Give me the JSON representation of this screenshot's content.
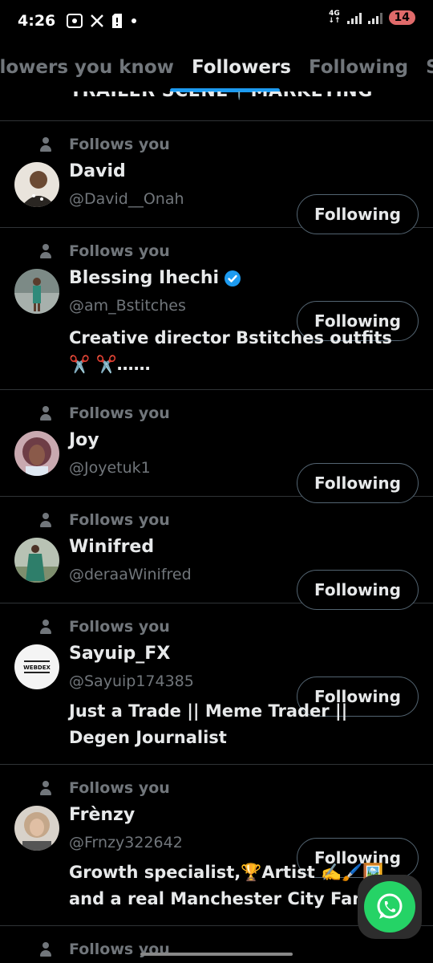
{
  "status": {
    "time": "4:26",
    "network": "4G",
    "battery": "14"
  },
  "tabs": [
    {
      "label": "Followers you know"
    },
    {
      "label": "Followers"
    },
    {
      "label": "Following"
    },
    {
      "label": "Subscriptions"
    }
  ],
  "partial_top_text": "TRAILER SCENE📍MARKETING",
  "follows_you_label": "Follows you",
  "button_label": "Following",
  "users": [
    {
      "name": "David",
      "handle": "@David__Onah",
      "bio": ""
    },
    {
      "name": "Blessing Ihechi",
      "handle": "@am_Bstitches",
      "bio": "Creative director Bstitches outfits ✂️ ✂️……",
      "verified": true
    },
    {
      "name": "Joy",
      "handle": "@Joyetuk1",
      "bio": ""
    },
    {
      "name": "Winifred",
      "handle": "@deraaWinifred",
      "bio": ""
    },
    {
      "name": "Sayuip_FX",
      "handle": "@Sayuip174385",
      "bio": "Just a Trade || Meme Trader || Degen Journalist"
    },
    {
      "name": "Frènzy",
      "handle": "@Frnzy322642",
      "bio": "Growth specialist,🏆Artist ✍️🖌️🖼️ and a real Manchester City Fan"
    }
  ],
  "avatar_texts": {
    "sayuip": "WEBDEX"
  },
  "colors": {
    "background": "#000000",
    "accent": "#1d9bf0",
    "secondary_text": "#71767b",
    "whatsapp": "#25d366"
  }
}
